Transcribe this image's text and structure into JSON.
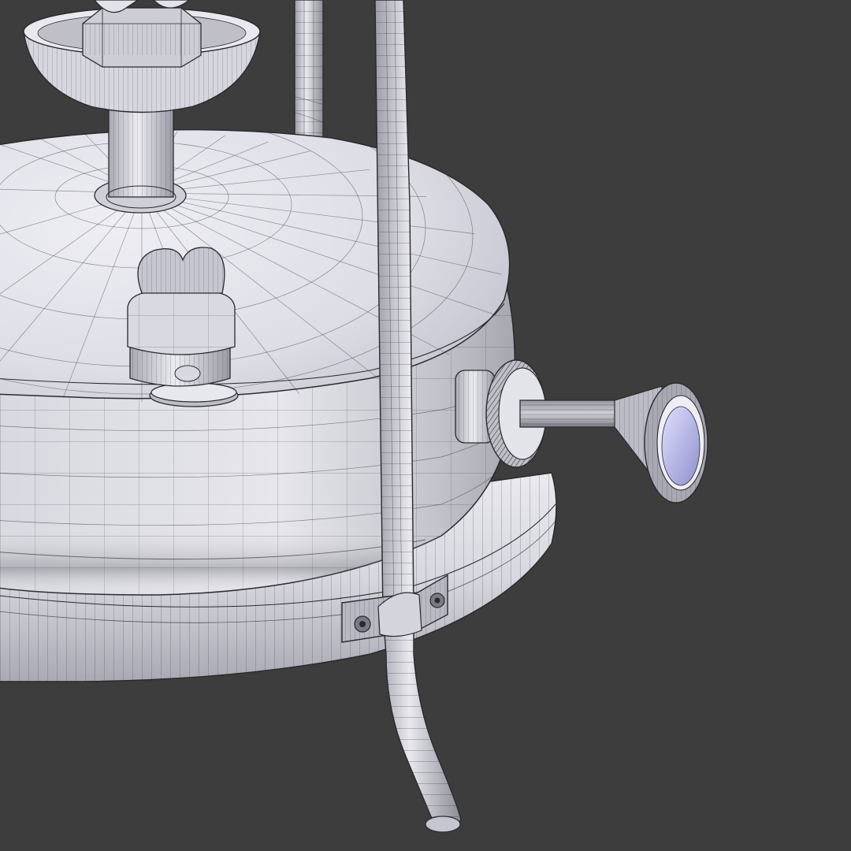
{
  "scene": {
    "subject": "",
    "colors": {
      "background": "#3d3d3d",
      "surface_light": "#ebebf2",
      "surface_mid": "#c9c9d4",
      "surface_dark": "#8c8c96",
      "wire": "#2a2a2e",
      "accent_blue": "#9a9ad8"
    }
  }
}
